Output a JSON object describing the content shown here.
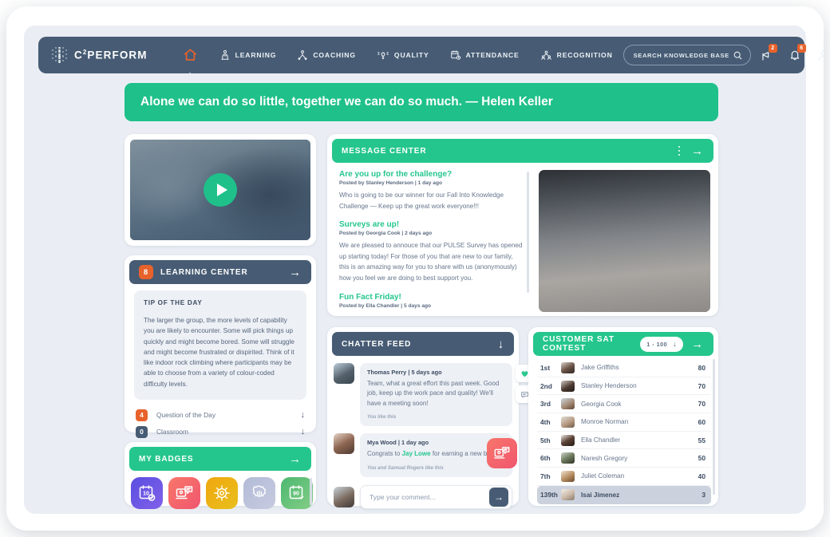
{
  "navbar": {
    "logo_text": "C",
    "logo_sup": "2",
    "logo_text2": "PERFORM",
    "items": [
      {
        "label": "",
        "icon": "home-icon",
        "active": true
      },
      {
        "label": "LEARNING",
        "icon": "learning-icon",
        "active": false
      },
      {
        "label": "COACHING",
        "icon": "coaching-icon",
        "active": false
      },
      {
        "label": "QUALITY",
        "icon": "quality-icon",
        "active": false
      },
      {
        "label": "ATTENDANCE",
        "icon": "attendance-icon",
        "active": false
      },
      {
        "label": "RECOGNITION",
        "icon": "recognition-icon",
        "active": false
      }
    ],
    "search_placeholder": "SEARCH KNOWLEDGE BASE",
    "search_value": "",
    "announcements_badge": "2",
    "notifications_badge": "6",
    "colors": {
      "bar": "#475C74",
      "accent_orange": "#E8622B",
      "accent_green": "#25C68D"
    }
  },
  "quote": {
    "text": "Alone we can do so little, together we can do so much. — Helen Keller"
  },
  "video": {
    "play_label": "play-video"
  },
  "learning_center": {
    "title": "LEARNING CENTER",
    "count": "8",
    "tip_title": "TIP OF THE DAY",
    "tip_body": "The larger the group, the more levels of capability you are likely to encounter. Some will pick things up quickly and might become bored. Some will struggle and might become frustrated or dispirited. Think of it like indoor rock climbing where participants may be able to choose from a variety of colour-coded difficulty levels.",
    "rows": [
      {
        "count": "4",
        "label": "Question of the Day",
        "style": "orange"
      },
      {
        "count": "0",
        "label": "Classroom",
        "style": "dark"
      }
    ]
  },
  "badges": {
    "title": "MY BADGES",
    "items": [
      {
        "name": "ten-day-calendar-badge",
        "color1": "#5a4fe0",
        "color2": "#7b5ce8",
        "icon": "calendar-10-icon"
      },
      {
        "name": "feedback-badge",
        "color1": "#f8776a",
        "color2": "#f2607a",
        "icon": "presentation-chat-icon"
      },
      {
        "name": "gear-star-badge",
        "color1": "#f0a70f",
        "color2": "#e6b919",
        "icon": "gear-sun-icon"
      },
      {
        "name": "rosette-badge",
        "color1": "#b3bbd6",
        "color2": "#c0c6dd",
        "icon": "rosette-icon"
      },
      {
        "name": "ninety-day-calendar-badge",
        "color1": "#4cb870",
        "color2": "#76c97f",
        "icon": "calendar-90-icon"
      }
    ]
  },
  "message_center": {
    "title": "MESSAGE CENTER",
    "messages": [
      {
        "title": "Are you up for the challenge?",
        "meta": "Posted by Stanley Henderson | 1 day ago",
        "body": "Who is going to be our winner for our Fall Into Knowledge Challenge —  Keep up the great work everyone!!!"
      },
      {
        "title": "Surveys are up!",
        "meta": "Posted by Georgia Cook | 2 days ago",
        "body": "We are pleased to annouce that our PULSE Survey has opened up starting today! For those of you that are new to our  family, this is an amazing way for you to share with us (anonymously) how you feel we are doing to best support you."
      },
      {
        "title": "Fun Fact Friday!",
        "meta": "Posted by Ella Chandler | 5 days ago",
        "body": ""
      }
    ]
  },
  "chatter_feed": {
    "title": "CHATTER FEED",
    "posts": [
      {
        "name": "Thomas Perry | 5 days ago",
        "text": "Team, what a great effort this past week. Good job, keep up the work pace and quality! We'll have a meeting soon!",
        "likes": "You like this",
        "reactions": [
          "heart-icon",
          "comment-icon"
        ]
      },
      {
        "name": "Mya Wood | 1 day ago",
        "text_before": "Congrats to ",
        "mention": "Jay Lowe",
        "text_after": " for earning a new badge!",
        "likes": "You and Samual Rogers like this"
      }
    ],
    "comment_placeholder": "Type your comment...",
    "comment_value": ""
  },
  "leaderboard": {
    "title": "CUSTOMER SAT CONTEST",
    "range_label": "1 - 100",
    "rows": [
      {
        "rank": "1st",
        "name": "Jake Griffiths",
        "score": "80",
        "me": false
      },
      {
        "rank": "2nd",
        "name": "Stanley Henderson",
        "score": "70",
        "me": false
      },
      {
        "rank": "3rd",
        "name": "Georgia Cook",
        "score": "70",
        "me": false
      },
      {
        "rank": "4th",
        "name": "Monroe Norman",
        "score": "60",
        "me": false
      },
      {
        "rank": "5th",
        "name": "Ella Chandler",
        "score": "55",
        "me": false
      },
      {
        "rank": "6th",
        "name": "Naresh Gregory",
        "score": "50",
        "me": false
      },
      {
        "rank": "7th",
        "name": "Juliet Coleman",
        "score": "40",
        "me": false
      },
      {
        "rank": "139th",
        "name": "Isai Jimenez",
        "score": "3",
        "me": true
      }
    ]
  }
}
